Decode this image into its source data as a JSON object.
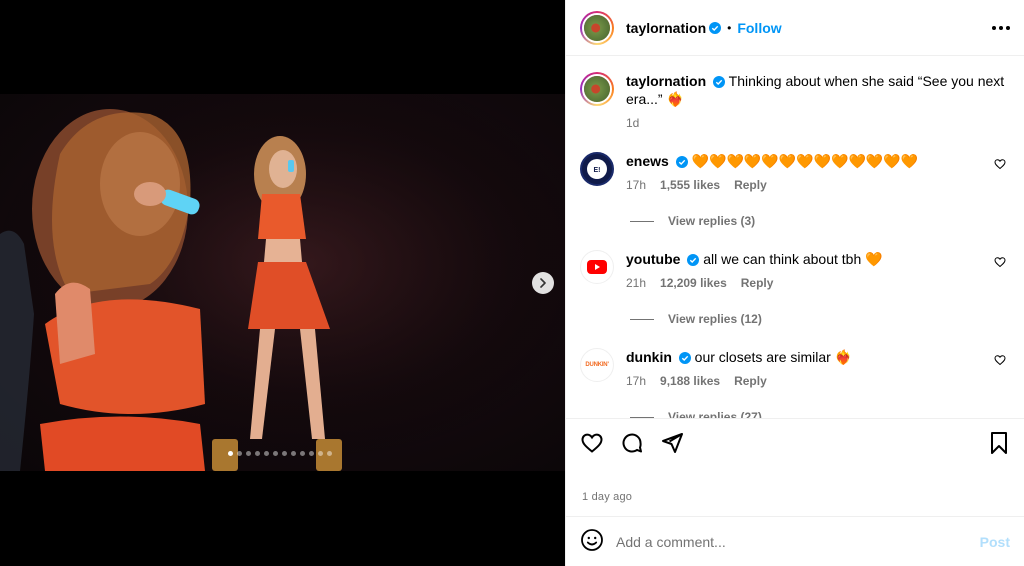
{
  "post": {
    "author": "taylornation",
    "follow_label": "Follow",
    "separator": "•",
    "more_icon": "more-horizontal-icon",
    "media": {
      "slide_count": 12,
      "active_slide": 1,
      "next_icon": "chevron-right-icon"
    }
  },
  "caption": {
    "user": "taylornation",
    "text": "Thinking about when she said “See you next era...” ❤️‍🔥",
    "age": "1d"
  },
  "comments": [
    {
      "user": "enews",
      "text": "🧡🧡🧡🧡🧡🧡🧡🧡🧡🧡🧡🧡🧡",
      "age": "17h",
      "likes": "1,555 likes",
      "reply_label": "Reply",
      "view_replies": "View replies (3)"
    },
    {
      "user": "youtube",
      "text": "all we can think about tbh 🧡",
      "age": "21h",
      "likes": "12,209 likes",
      "reply_label": "Reply",
      "view_replies": "View replies (12)"
    },
    {
      "user": "dunkin",
      "text": "our closets are similar ❤️‍🔥",
      "age": "17h",
      "likes": "9,188 likes",
      "reply_label": "Reply",
      "view_replies": "View replies (27)",
      "avatar_text": "DUNKIN'"
    }
  ],
  "actions": {
    "like_icon": "heart-icon",
    "comment_icon": "comment-icon",
    "share_icon": "share-icon",
    "save_icon": "bookmark-icon",
    "posted_ago": "1 day ago"
  },
  "composer": {
    "placeholder": "Add a comment...",
    "post_label": "Post",
    "emoji_icon": "emoji-icon"
  },
  "colors": {
    "link": "#0095f6",
    "muted": "#737373",
    "post_disabled": "#b2dffc",
    "verified": "#0095f6"
  }
}
